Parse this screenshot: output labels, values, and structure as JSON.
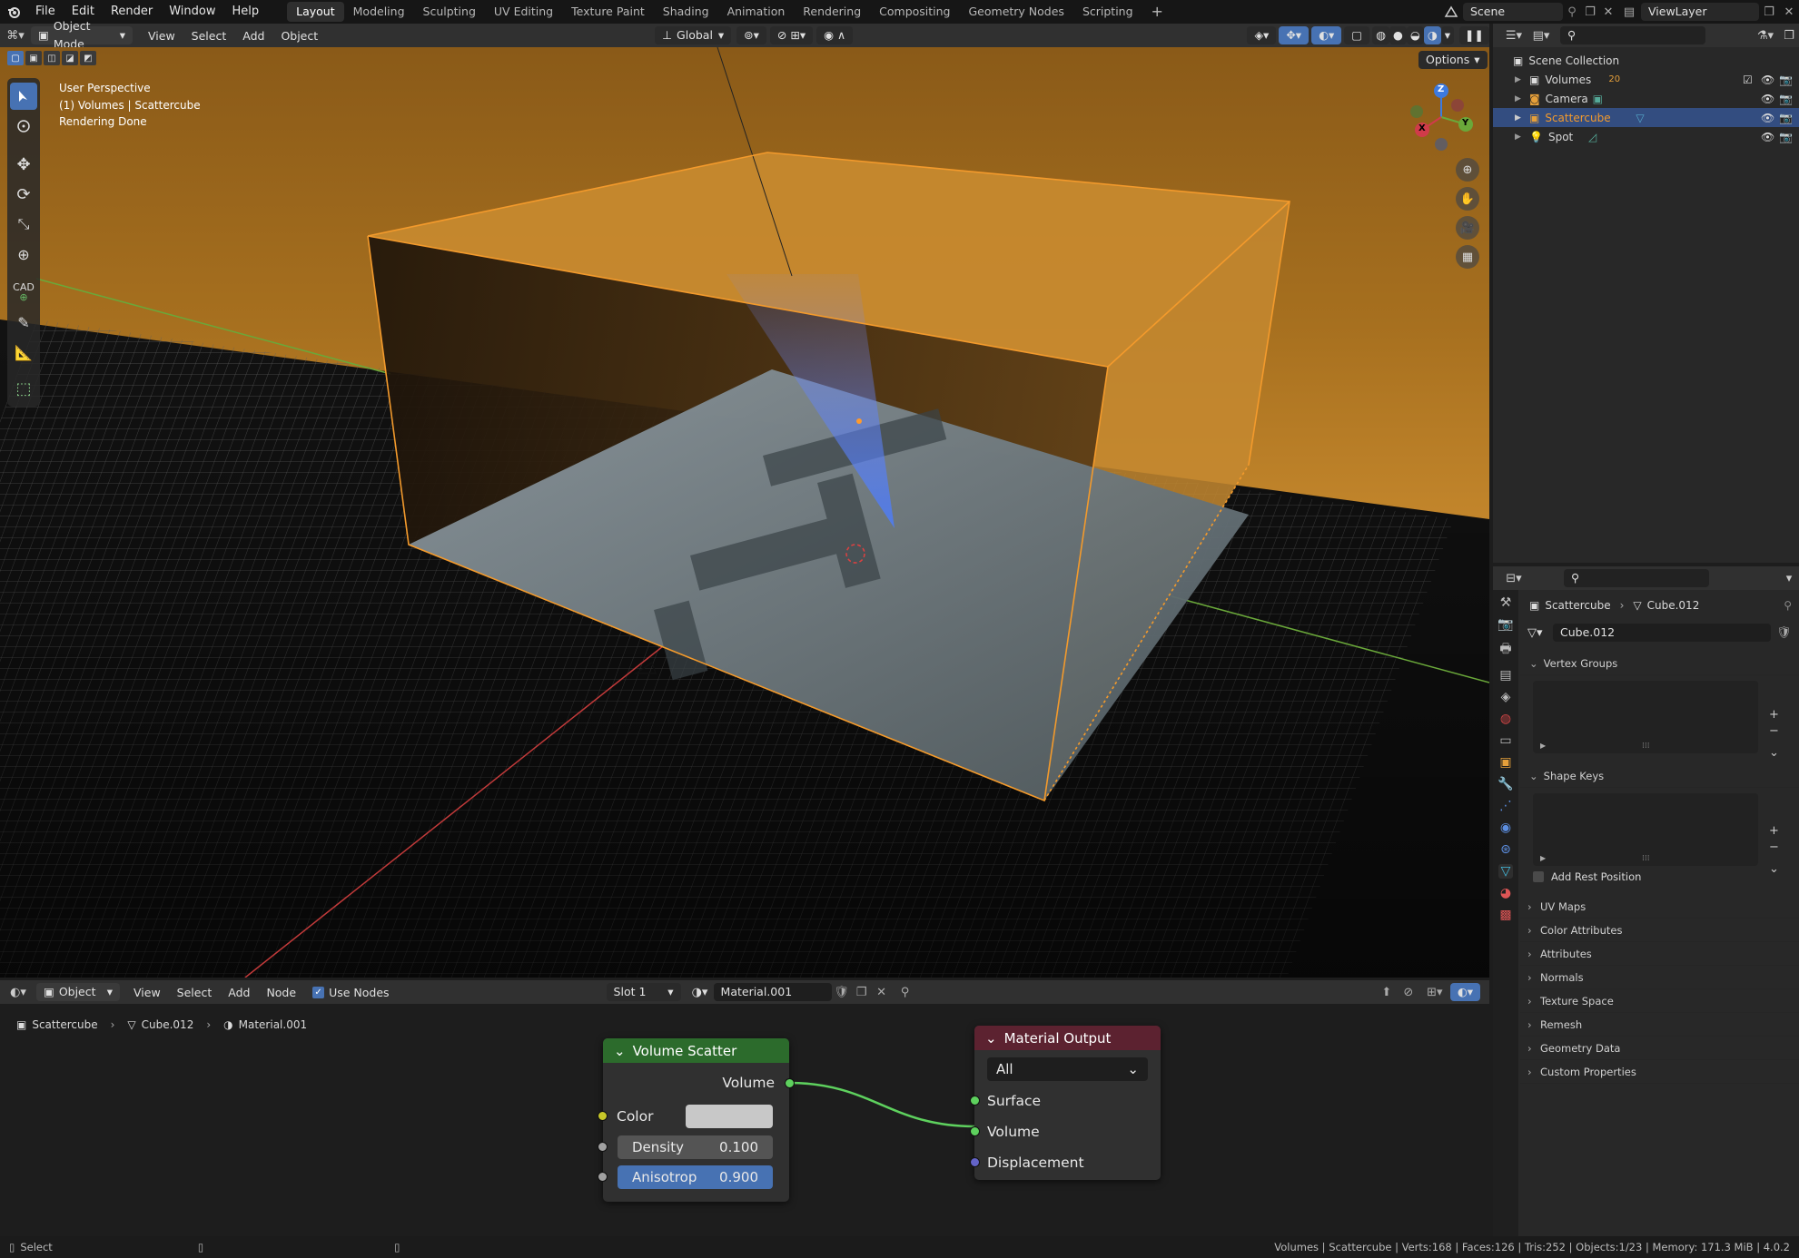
{
  "topbar": {
    "menus": [
      "File",
      "Edit",
      "Render",
      "Window",
      "Help"
    ],
    "workspaces": [
      "Layout",
      "Modeling",
      "Sculpting",
      "UV Editing",
      "Texture Paint",
      "Shading",
      "Animation",
      "Rendering",
      "Compositing",
      "Geometry Nodes",
      "Scripting"
    ],
    "scene": "Scene",
    "view_layer": "ViewLayer"
  },
  "viewport": {
    "mode": "Object Mode",
    "menus": [
      "View",
      "Select",
      "Add",
      "Object"
    ],
    "orientation": "Global",
    "options_label": "Options",
    "overlay_lines": [
      "User Perspective",
      "(1) Volumes | Scattercube",
      "Rendering Done"
    ],
    "gizmo_axes": {
      "x": "X",
      "y": "Y",
      "z": "Z"
    },
    "cad_label": "CAD"
  },
  "outliner": {
    "root": "Scene Collection",
    "items": [
      {
        "name": "Volumes",
        "badge": "20",
        "selected": false
      },
      {
        "name": "Camera",
        "selected": false
      },
      {
        "name": "Scattercube",
        "selected": true
      },
      {
        "name": "Spot",
        "selected": false
      }
    ]
  },
  "properties": {
    "breadcrumb_object": "Scattercube",
    "breadcrumb_data": "Cube.012",
    "mesh_name": "Cube.012",
    "vertex_groups": "Vertex Groups",
    "shape_keys": "Shape Keys",
    "add_rest_position": "Add Rest Position",
    "panels": [
      "UV Maps",
      "Color Attributes",
      "Attributes",
      "Normals",
      "Texture Space",
      "Remesh",
      "Geometry Data",
      "Custom Properties"
    ]
  },
  "node_editor": {
    "mode": "Object",
    "menus": [
      "View",
      "Select",
      "Add",
      "Node"
    ],
    "use_nodes": "Use Nodes",
    "slot": "Slot 1",
    "material": "Material.001",
    "breadcrumb": [
      "Scattercube",
      "Cube.012",
      "Material.001"
    ],
    "volume_scatter": {
      "title": "Volume Scatter",
      "output": "Volume",
      "color_label": "Color",
      "density_label": "Density",
      "density_value": "0.100",
      "anisotropy_label": "Anisotrop",
      "anisotropy_value": "0.900"
    },
    "material_output": {
      "title": "Material Output",
      "target": "All",
      "inputs": [
        "Surface",
        "Volume",
        "Displacement"
      ]
    }
  },
  "statusbar": {
    "left": "Select",
    "right": "Volumes | Scattercube | Verts:168 | Faces:126 | Tris:252 | Objects:1/23 | Memory: 171.3 MiB | 4.0.2"
  },
  "colors": {
    "accent": "#4772b3",
    "selection": "#f39a2c",
    "node_green": "#2c6b2c",
    "node_red": "#5c2230"
  }
}
